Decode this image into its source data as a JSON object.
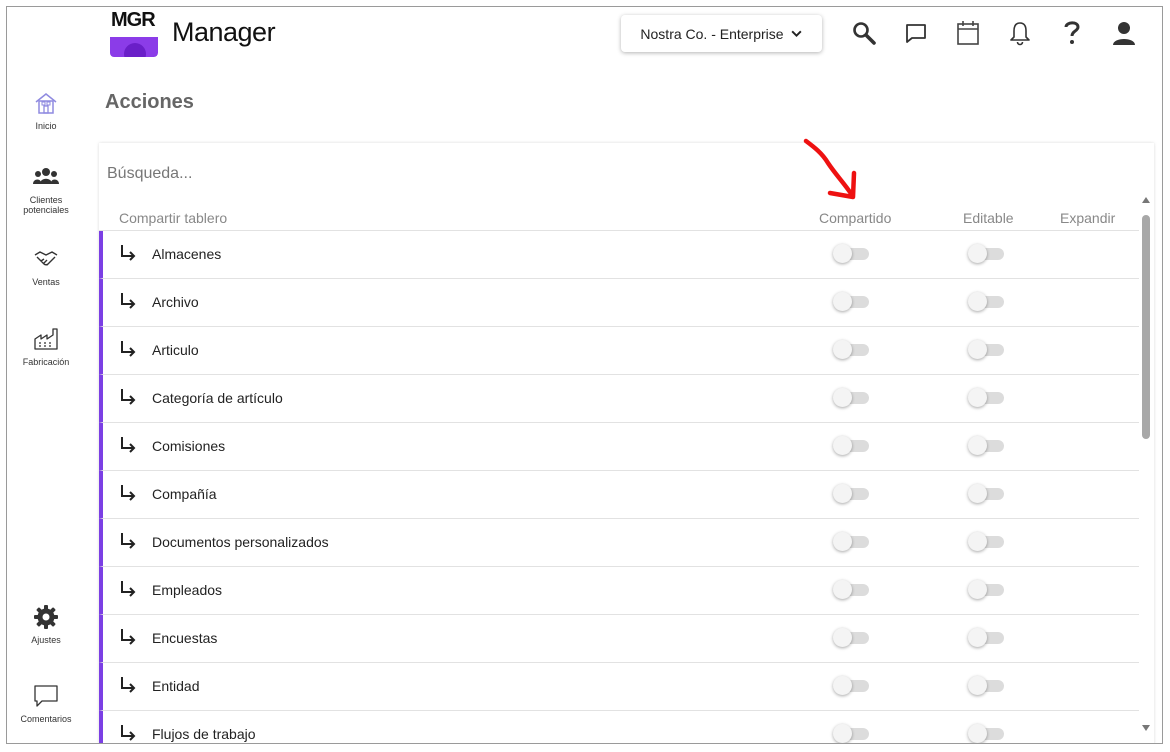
{
  "header": {
    "logo_text": "MGR",
    "app_title": "Manager",
    "company_selector": "Nostra Co. - Enterprise",
    "icons": [
      "search-icon",
      "chat-icon",
      "calendar-icon",
      "bell-icon",
      "help-icon",
      "user-icon"
    ]
  },
  "nav": {
    "items": [
      {
        "label": "Inicio",
        "icon": "home-icon"
      },
      {
        "label_line1": "Clientes",
        "label_line2": "potenciales",
        "icon": "people-icon"
      },
      {
        "label": "Ventas",
        "icon": "handshake-icon"
      },
      {
        "label": "Fabricación",
        "icon": "factory-icon"
      },
      {
        "label": "Ajustes",
        "icon": "gear-icon"
      },
      {
        "label": "Comentarios",
        "icon": "comment-icon"
      }
    ]
  },
  "page": {
    "title": "Acciones"
  },
  "search": {
    "placeholder": "Búsqueda..."
  },
  "columns": {
    "name": "Compartir tablero",
    "shared": "Compartido",
    "editable": "Editable",
    "expand": "Expandir"
  },
  "rows": [
    {
      "label": "Almacenes",
      "shared": false,
      "editable": false
    },
    {
      "label": "Archivo",
      "shared": false,
      "editable": false
    },
    {
      "label": "Articulo",
      "shared": false,
      "editable": false
    },
    {
      "label": "Categoría de artículo",
      "shared": false,
      "editable": false
    },
    {
      "label": "Comisiones",
      "shared": false,
      "editable": false
    },
    {
      "label": "Compañía",
      "shared": false,
      "editable": false
    },
    {
      "label": "Documentos personalizados",
      "shared": false,
      "editable": false
    },
    {
      "label": "Empleados",
      "shared": false,
      "editable": false
    },
    {
      "label": "Encuestas",
      "shared": false,
      "editable": false
    },
    {
      "label": "Entidad",
      "shared": false,
      "editable": false
    },
    {
      "label": "Flujos de trabajo",
      "shared": false,
      "editable": false
    }
  ],
  "colors": {
    "accent": "#7b3fe4",
    "logo_band": "#8b3ce8",
    "annotation_arrow": "#ee1111"
  }
}
